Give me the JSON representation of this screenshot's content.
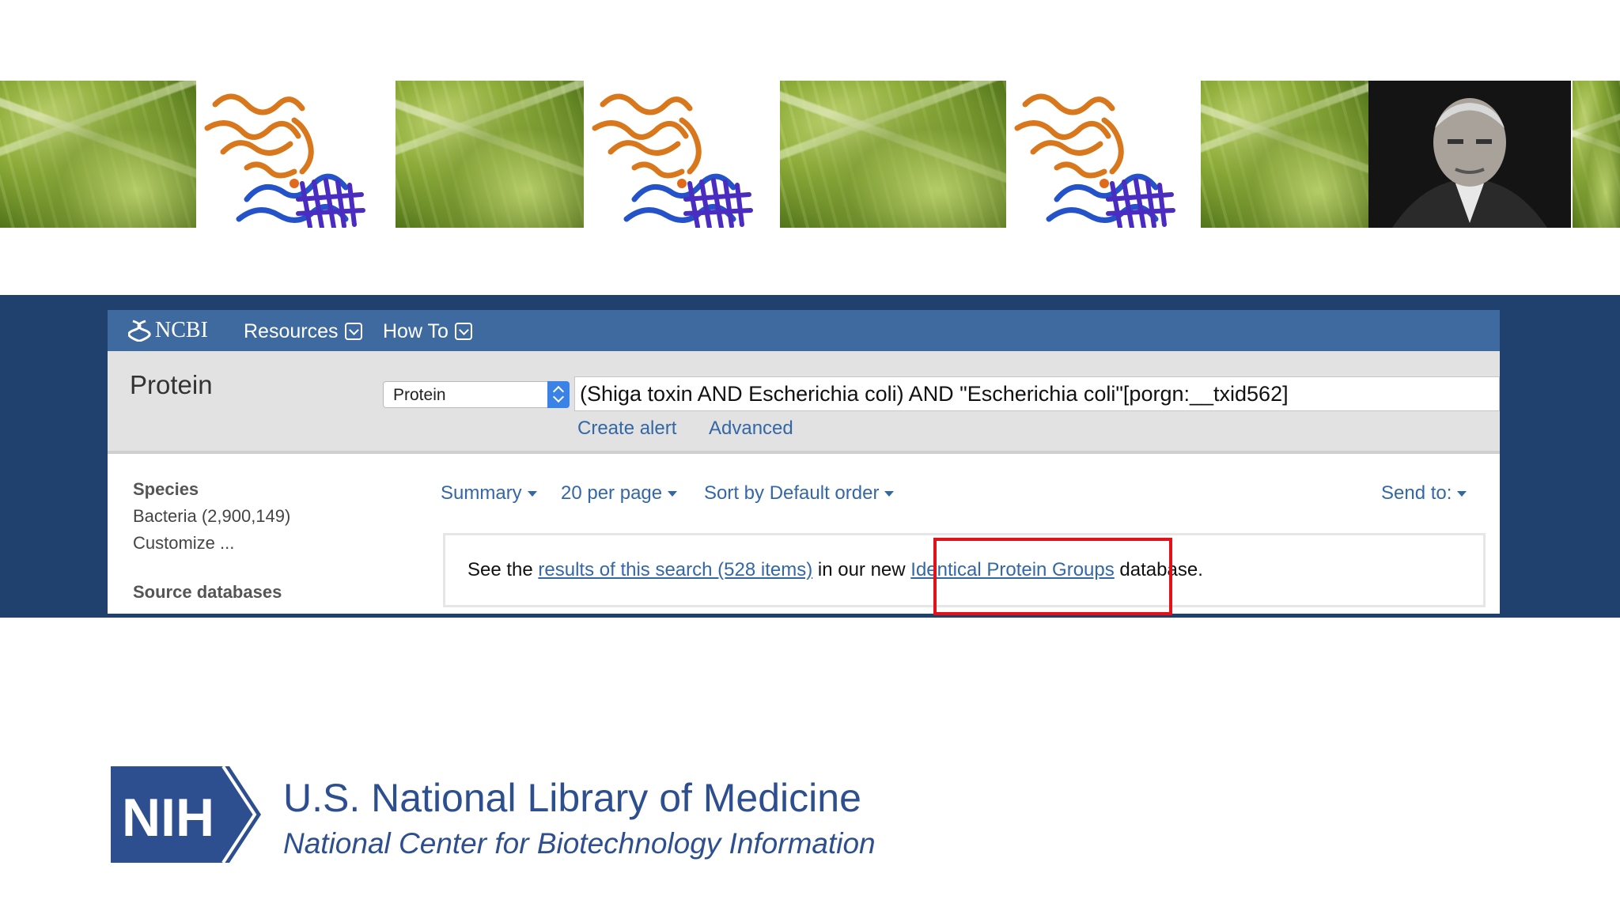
{
  "top_strip": {
    "tiles": [
      {
        "kind": "lettuce",
        "icon": "lettuce-photo"
      },
      {
        "kind": "protein",
        "icon": "protein-structure-image"
      },
      {
        "kind": "lettuce",
        "icon": "lettuce-photo"
      },
      {
        "kind": "protein",
        "icon": "protein-structure-image"
      },
      {
        "kind": "lettuce",
        "icon": "lettuce-photo"
      },
      {
        "kind": "protein",
        "icon": "protein-structure-image"
      },
      {
        "kind": "lettuce",
        "icon": "lettuce-photo"
      },
      {
        "kind": "portrait",
        "icon": "portrait-photo"
      },
      {
        "kind": "lettuce",
        "icon": "lettuce-photo"
      }
    ]
  },
  "ncbi": {
    "logo": "NCBI",
    "menu": [
      "Resources",
      "How To"
    ],
    "db_title": "Protein",
    "db_select": "Protein",
    "query": "(Shiga toxin AND Escherichia coli) AND \"Escherichia coli\"[porgn:__txid562]",
    "create_alert": "Create alert",
    "advanced": "Advanced",
    "left": {
      "species_heading": "Species",
      "species_item": "Bacteria (2,900,149)",
      "customize": "Customize ...",
      "source_heading": "Source databases"
    },
    "controls": {
      "summary": "Summary",
      "per_page": "20 per page",
      "sort": "Sort by Default order",
      "send_to": "Send to:"
    },
    "notice": {
      "prefix": "See the ",
      "results_link": "results of this search (528 items)",
      "middle": " in our new ",
      "ipg_link": "Identical Protein Groups",
      "suffix": " database."
    },
    "colors": {
      "header": "#3e6aa0",
      "band": "#20406e",
      "link": "#3367a6",
      "highlight": "#e3121a"
    }
  },
  "footer": {
    "badge": "NIH",
    "title": "U.S. National Library of Medicine",
    "subtitle": "National Center for Biotechnology Information",
    "brand_color": "#2e4f8f"
  }
}
